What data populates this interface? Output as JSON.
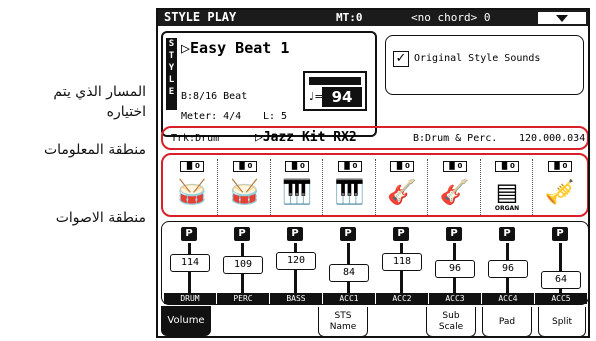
{
  "annotations": {
    "selected_track": "المسار الذي يتم\nاختياره",
    "info_area": "منطقة المعلومات",
    "sounds_area": "منطقة الاصوات"
  },
  "header": {
    "mode": "STYLE PLAY",
    "metronome": "MT:0",
    "chord": "<no chord> 0"
  },
  "style": {
    "vertical_label": "STYLE",
    "name": "Easy Beat 1",
    "beat": "B:8/16 Beat",
    "meter": "Meter: 4/4",
    "length": "L: 5",
    "tempo": "94",
    "tempo_note": "♩="
  },
  "original_sounds": {
    "label": "Original Style Sounds",
    "checked": true
  },
  "track_info": {
    "track": "Trk:Drum",
    "sound": "▷Jazz Kit RX2",
    "bank": "B:Drum & Perc.",
    "program": "120.000.034"
  },
  "sounds": [
    {
      "mini": "▐▌0",
      "icon": "🥁",
      "icon_name": "drum-kit-icon"
    },
    {
      "mini": "▐▌0",
      "icon": "🥁",
      "icon_name": "drum-kit-icon"
    },
    {
      "mini": "▐▌0",
      "icon": "🎹",
      "icon_name": "bass-icon"
    },
    {
      "mini": "▐▌0",
      "icon": "🎹",
      "icon_name": "piano-icon"
    },
    {
      "mini": "▐▌0",
      "icon": "🎸",
      "icon_name": "guitar-icon"
    },
    {
      "mini": "▐▌0",
      "icon": "🎸",
      "icon_name": "guitar-icon"
    },
    {
      "mini": "▐▌0",
      "icon": "▤",
      "icon_name": "organ-icon",
      "label": "ORGAN"
    },
    {
      "mini": "▐▌0",
      "icon": "🎺",
      "icon_name": "brass-icon"
    }
  ],
  "mixer": [
    {
      "p": "P",
      "value": "114",
      "label": "DRUM",
      "level": 0.78
    },
    {
      "p": "P",
      "value": "109",
      "label": "PERC",
      "level": 0.75
    },
    {
      "p": "P",
      "value": "120",
      "label": "BASS",
      "level": 0.82
    },
    {
      "p": "P",
      "value": "84",
      "label": "ACC1",
      "level": 0.58
    },
    {
      "p": "P",
      "value": "118",
      "label": "ACC2",
      "level": 0.8
    },
    {
      "p": "P",
      "value": "96",
      "label": "ACC3",
      "level": 0.66
    },
    {
      "p": "P",
      "value": "96",
      "label": "ACC4",
      "level": 0.66
    },
    {
      "p": "P",
      "value": "64",
      "label": "ACC5",
      "level": 0.44
    }
  ],
  "tabs": [
    {
      "label": "Volume",
      "active": true
    },
    {
      "label": "STS Name",
      "active": false
    },
    {
      "label": "Sub Scale",
      "active": false
    },
    {
      "label": "Pad",
      "active": false
    },
    {
      "label": "Split",
      "active": false
    }
  ]
}
